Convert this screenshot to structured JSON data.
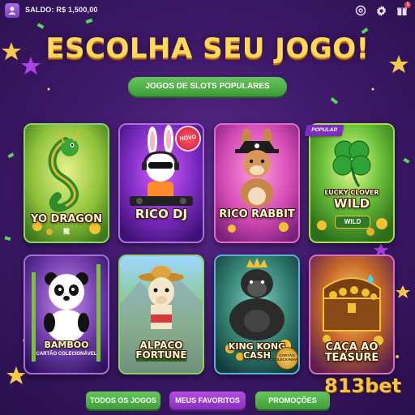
{
  "topbar": {
    "balance": "SALDO: R$ 1,500,00",
    "icons": [
      "user-icon",
      "settings-outline-icon",
      "gear-icon",
      "gift-icon"
    ],
    "gift_badge": "1"
  },
  "title": "ESCOLHA SEU JOGO!",
  "section_label": "JOGOS DE SLOTS POPULARES",
  "games": [
    {
      "name": "YO DRAGON",
      "sub": "龍"
    },
    {
      "name": "RICO DJ",
      "badge": "NOVO"
    },
    {
      "name": "RICO RABBIT"
    },
    {
      "name": "LUCKY CLOVER WILD",
      "badge": "POPULAR",
      "tag": "WILD"
    },
    {
      "name": "BAMBOO",
      "sub": "CARTÃO COLECIONÁVEL"
    },
    {
      "name": "ALPACO FORTUNE"
    },
    {
      "name": "KING KONG CASH",
      "sub": "CARTÃO COLECIONÁVEL"
    },
    {
      "name": "CAÇA AO TEASURE"
    }
  ],
  "buttons": {
    "all_games": "TODOS OS JOGOS",
    "favorites": "MEUS FAVORITOS",
    "promotions": "PROMOÇÕES"
  },
  "watermark": "813bet",
  "colors": {
    "accent_green": "#4caf50",
    "accent_purple": "#9c3dd0",
    "title_gold": "#ffd95a"
  }
}
